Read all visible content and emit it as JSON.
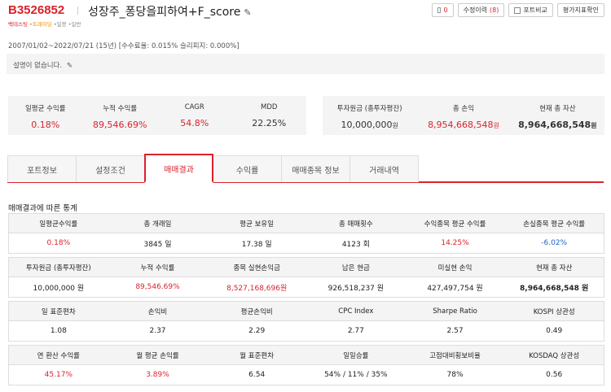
{
  "header": {
    "code": "B3526852",
    "title": "성장주_퐁당을피하여+F_score",
    "buttons": {
      "notify_count": "0",
      "history_label": "수정이력",
      "history_count": "(8)",
      "compare_label": "포트비교",
      "eval_label": "평가지표확인"
    },
    "tags": [
      "백테스팅",
      "•트레이딩",
      "•일봉",
      "•일반"
    ]
  },
  "period": "2007/01/02~2022/07/21 (15년) [수수료율: 0.015% 슬리피지: 0.000%]",
  "description": "설명이 없습니다.",
  "summary_left": [
    {
      "label": "일평균 수익률",
      "value": "0.18%"
    },
    {
      "label": "누적 수익률",
      "value": "89,546.69%"
    },
    {
      "label": "CAGR",
      "value": "54.8%"
    },
    {
      "label": "MDD",
      "value": "22.25%"
    }
  ],
  "summary_right": [
    {
      "label": "투자원금 (총투자평잔)",
      "value": "10,000,000",
      "unit": "원"
    },
    {
      "label": "총 손익",
      "value": "8,954,668,548",
      "unit": "원"
    },
    {
      "label": "현재 총 자산",
      "value": "8,964,668,548",
      "unit": "원"
    }
  ],
  "tabs": [
    "포트정보",
    "설정조건",
    "매매결과",
    "수익률",
    "매매종목 정보",
    "거래내역"
  ],
  "section_title": "매매결과에 따른 통계",
  "stats": [
    {
      "headers": [
        "일평균수익률",
        "총 개래일",
        "평균 보유일",
        "총 매매횟수",
        "수익종목 평균 수익률",
        "손실종목 평균 수익률"
      ],
      "values": [
        "0.18%",
        "3845 일",
        "17.38 일",
        "4123 회",
        "14.25%",
        "-6.02%"
      ]
    },
    {
      "headers": [
        "투자원금 (총투자평잔)",
        "누적 수익률",
        "종목 실현손익금",
        "남은 현금",
        "미실현 손익",
        "현재 총 자산"
      ],
      "values": [
        "10,000,000 원",
        "89,546.69%",
        "8,527,168,696원",
        "926,518,237 원",
        "427,497,754 원",
        "8,964,668,548 원"
      ]
    },
    {
      "headers": [
        "일 표준편차",
        "손익비",
        "평균손익비",
        "CPC Index",
        "Sharpe Ratio",
        "KOSPI 상관성"
      ],
      "values": [
        "1.08",
        "2.37",
        "2.29",
        "2.77",
        "2.57",
        "0.49"
      ]
    },
    {
      "headers": [
        "연 환산 수익률",
        "월 평균 손익률",
        "월 표준편차",
        "일일승률",
        "고점대비횡보비율",
        "KOSDAQ 상관성"
      ],
      "values": [
        "45.17%",
        "3.89%",
        "6.54",
        "54% / 11% / 35%",
        "78%",
        "0.56"
      ]
    }
  ]
}
